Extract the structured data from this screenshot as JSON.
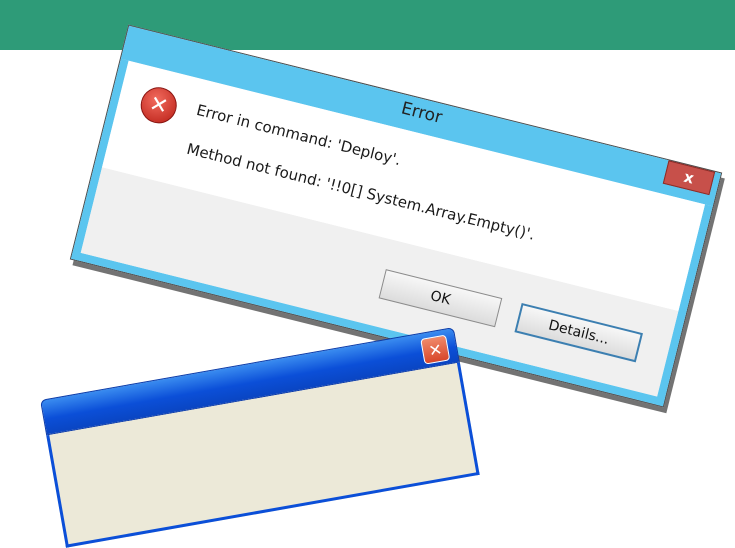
{
  "dialog": {
    "title": "Error",
    "close_glyph": "x",
    "icon": "error-icon",
    "icon_glyph": "✕",
    "message_line1": "Error in command: 'Deploy'.",
    "message_line2": "Method not found: '!!0[] System.Array.Empty()'.",
    "ok_label": "OK",
    "details_label": "Details...",
    "colors": {
      "titlebar": "#5bc5ef",
      "close": "#c7504a"
    }
  },
  "xp_window": {
    "close_glyph": "✕",
    "colors": {
      "titlebar": "#0b4fd8",
      "close": "#d8462a"
    }
  },
  "background": {
    "band_color": "#2e9b78"
  }
}
